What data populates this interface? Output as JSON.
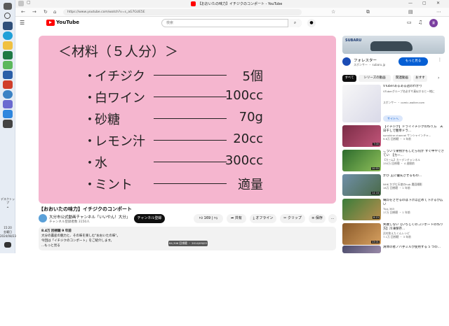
{
  "taskbar": {
    "desktop_label": "デスクトップ",
    "time": "15:20",
    "day": "金曜日",
    "date": "2024/08/23"
  },
  "browser": {
    "tab_title": "【おおいたの味力】イチジクのコンポート - YouTube",
    "url": "https://www.youtube.com/watch?v=s_aG7GUE5E"
  },
  "youtube": {
    "logo_text": "YouTube",
    "search_placeholder": "検索"
  },
  "video": {
    "heading": "＜材料（５人分）＞",
    "ingredients": [
      {
        "name": "イチジク",
        "amount": "5個"
      },
      {
        "name": "白ワイン",
        "amount": "100cc"
      },
      {
        "name": "砂糖",
        "amount": "70g"
      },
      {
        "name": "レモン汁",
        "amount": "20cc"
      },
      {
        "name": "水",
        "amount": "300cc"
      },
      {
        "name": "ミント",
        "amount": "適量"
      }
    ]
  },
  "video_info": {
    "title": "【おおいたの味力】イチジクのコンポート",
    "channel_name": "大分市公式動画チャンネル「いいやん！大分」",
    "channel_subs": "チャンネル登録者数 3150人",
    "subscribe_label": "チャンネル登録",
    "likes": "169",
    "share_label": "共有",
    "offline_label": "オフライン",
    "clip_label": "クリップ",
    "save_label": "保存",
    "more_label": "…",
    "views_date": "8.4万 回視聴  9 年前",
    "desc_line1": "大分の農産の魅力と、その味を楽しむ\"おおいたの味\"。",
    "desc_line2": "今回は「イチジクのコンポート」をご紹介します。",
    "desc_more": "...もっと見る",
    "tooltip": "84,306 回視聴 ・ 2014/09/03"
  },
  "sidebar": {
    "ad": {
      "brand": "SUBARU",
      "title": "フォレスター",
      "sponsor": "スポンサー ・ subaru.jp",
      "button": "もっと見る"
    },
    "chips": [
      "すべて",
      "シリーズの動画",
      "関連動画",
      "おすす"
    ],
    "recommendations": [
      {
        "title": "VTuberあるある話のわかり",
        "meta1": "VTuberグループ名必ずや真似すると一緒に",
        "meta2": "スポンサー ・ comic-walker.com",
        "duration": "",
        "button": "サイトへ"
      },
      {
        "title": "【イチジク】ドライイチジクの作り方　天日干しで簡単ドラ...",
        "meta1": "sunshine channel サンシャインチャ...",
        "meta2": "9.6万 回視聴 ・ 3 年前",
        "duration": "7:00"
      },
      {
        "title": "こういう果物がもしたら何か すぐ中やできてい　【カー...",
        "meta1": "【カーム】カーデンチャンネル",
        "meta2": "150万 回視聴 ・ 4 週間前",
        "duration": "10:55"
      },
      {
        "title": "かび 王に優先させるもの...",
        "meta1": "NHK かがむ天使のhub 農園撮影",
        "meta2": "16万 回視聴 ・ 1 年前",
        "duration": "14:18"
      },
      {
        "title": "縄印をさせるのは下げば止めて下げるが広い",
        "meta1": "Tips 363",
        "meta2": "17万 回視聴 ・ 1 年前",
        "duration": "8:15"
      },
      {
        "title": "失敗しない【いちじくのコンポートの作り方】冷凍保存...",
        "meta1": "浜村和えたくんレシピ",
        "meta2": "7.1万 回視聴 ・ 3 年前",
        "duration": "13:01"
      },
      {
        "title": "清体の者ノバ手ミルが使用する 5 つの...",
        "meta1": "",
        "meta2": "",
        "duration": ""
      }
    ]
  }
}
